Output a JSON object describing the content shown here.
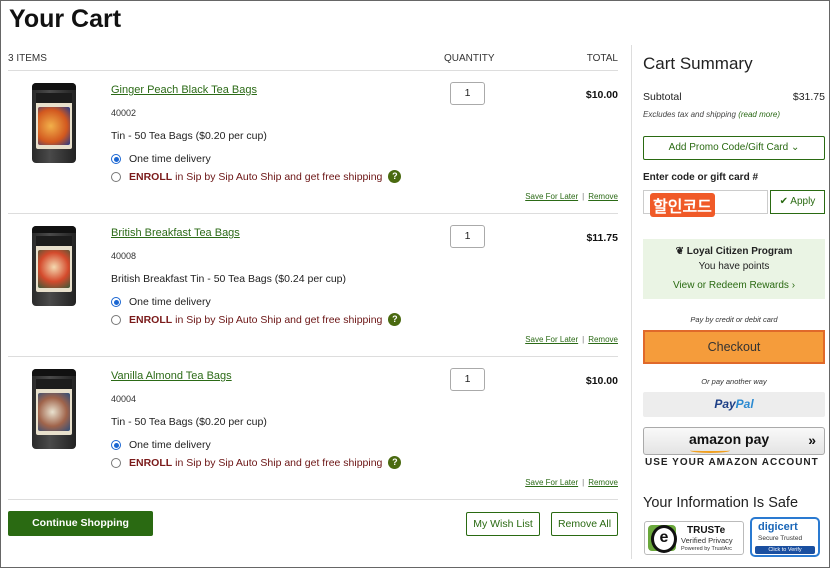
{
  "page": {
    "title": "Your Cart"
  },
  "cart": {
    "columns": {
      "items": "3 ITEMS",
      "quantity": "QUANTITY",
      "total": "TOTAL"
    },
    "items": [
      {
        "name": "Ginger Peach Black Tea Bags",
        "sku": "40002",
        "description": "Tin - 50 Tea Bags ($0.20 per cup)",
        "quantity": "1",
        "price": "$10.00"
      },
      {
        "name": "British Breakfast Tea Bags",
        "sku": "40008",
        "description": "British Breakfast Tin - 50 Tea Bags ($0.24 per cup)",
        "quantity": "1",
        "price": "$11.75"
      },
      {
        "name": "Vanilla Almond Tea Bags",
        "sku": "40004",
        "description": "Tin - 50 Tea Bags ($0.20 per cup)",
        "quantity": "1",
        "price": "$10.00"
      }
    ],
    "delivery": {
      "one_time": "One time delivery",
      "enroll_bold": "ENROLL",
      "enroll_rest": "in Sip by Sip Auto Ship and get free shipping"
    },
    "links": {
      "save": "Save For Later",
      "sep": "|",
      "remove": "Remove"
    },
    "buttons": {
      "continue": "Continue Shopping",
      "wishlist": "My Wish List",
      "remove_all": "Remove All"
    }
  },
  "summary": {
    "title": "Cart Summary",
    "subtotal_label": "Subtotal",
    "subtotal_value": "$31.75",
    "tax_note": "Excludes tax and shipping",
    "read_more": "(read more)",
    "promo_button": "Add Promo Code/Gift Card",
    "code_label": "Enter code or gift card #",
    "code_value": "할인코드",
    "apply": "Apply",
    "loyalty": {
      "title": "Loyal Citizen Program",
      "points": "You have points",
      "link": "View or Redeem Rewards"
    },
    "pay_by_card": "Pay by credit or debit card",
    "checkout": "Checkout",
    "or_pay": "Or pay another way",
    "paypal_a": "Pay",
    "paypal_b": "Pal",
    "amazon_pay": "amazon pay",
    "amazon_chev": "»",
    "amazon_note": "USE YOUR AMAZON ACCOUNT",
    "safe_title": "Your Information Is Safe",
    "truste": {
      "name": "TRUSTe",
      "line1": "Verified Privacy",
      "line2": "Powered by TrustArc"
    },
    "digicert": {
      "name": "digicert",
      "line1": "Secure  Trusted",
      "line2": "Click to Verify"
    }
  },
  "colors": {
    "brand_green": "#2a6a12",
    "checkout_orange": "#f59c3b",
    "link_green": "#2b6a16"
  }
}
